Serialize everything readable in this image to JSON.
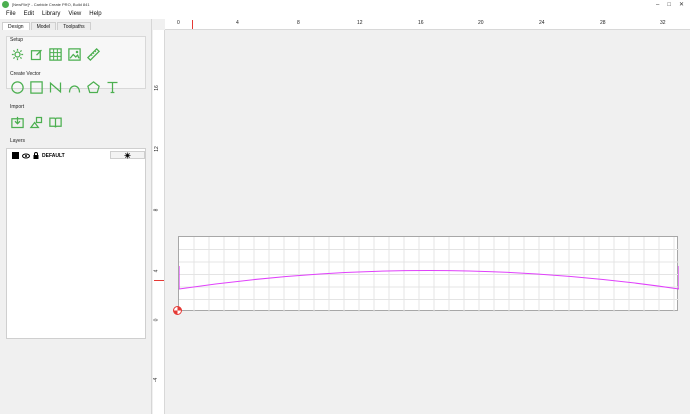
{
  "window": {
    "title": "[NewFile]* - Carbide Create PRO, Build 841",
    "controls": {
      "minimize": "–",
      "maximize": "□",
      "close": "✕"
    }
  },
  "menu": [
    "File",
    "Edit",
    "Library",
    "View",
    "Help"
  ],
  "left_panel": {
    "tabs": [
      "Design",
      "Model",
      "Toolpaths"
    ],
    "sections": {
      "setup": "Setup",
      "create_vector": "Create Vector",
      "import": "Import",
      "layers": "Layers"
    },
    "layer": {
      "name": "DEFAULT",
      "color": "#000000"
    }
  },
  "rulers": {
    "top_labels": [
      "0",
      "4",
      "8",
      "12",
      "16",
      "20",
      "24",
      "28",
      "32"
    ],
    "left_labels": [
      "16",
      "12",
      "8",
      "4",
      "0",
      "-4"
    ]
  },
  "colors": {
    "accent_green": "#4caf50",
    "vector_path": "#e040fb",
    "origin_red": "#e53935"
  }
}
